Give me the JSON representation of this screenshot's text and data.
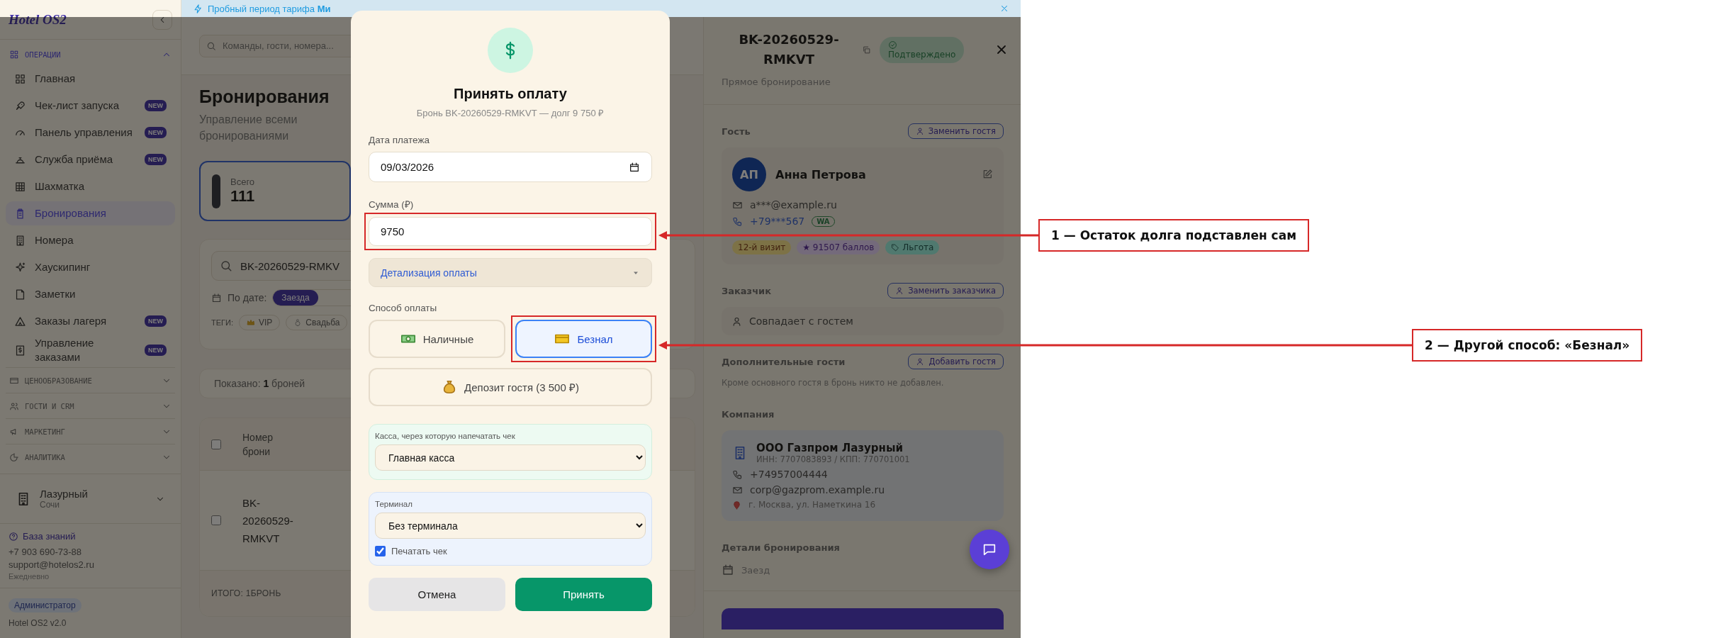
{
  "banner": {
    "text": "Пробный период тарифа **Ми**"
  },
  "sidebar": {
    "logo": "Hotel OS2",
    "sections": [
      {
        "title": "ОПЕРАЦИИ",
        "expanded": true,
        "items": [
          {
            "label": "Главная",
            "selected": false
          },
          {
            "label": "Чек-лист запуска",
            "selected": false,
            "badge": "NEW"
          },
          {
            "label": "Панель управления",
            "selected": false,
            "badge": "NEW"
          },
          {
            "label": "Служба приёма",
            "selected": false,
            "badge": "NEW"
          },
          {
            "label": "Шахматка",
            "selected": false
          },
          {
            "label": "Бронирования",
            "selected": true
          },
          {
            "label": "Номера",
            "selected": false
          },
          {
            "label": "Хаускипинг",
            "selected": false
          },
          {
            "label": "Заметки",
            "selected": false
          },
          {
            "label": "Заказы лагеря",
            "selected": false,
            "badge": "NEW"
          },
          {
            "label": "Управление заказами",
            "selected": false,
            "badge": "NEW"
          }
        ]
      },
      {
        "title": "ЦЕНООБРАЗОВАНИЕ",
        "expanded": false
      },
      {
        "title": "ГОСТИ И CRM",
        "expanded": false
      },
      {
        "title": "МАРКЕТИНГ",
        "expanded": false
      },
      {
        "title": "АНАЛИТИКА",
        "expanded": false
      }
    ],
    "property": {
      "name": "Лазурный",
      "city": "Сочи"
    },
    "help": {
      "link": "База знаний",
      "phone": "+7 903 690-73-88",
      "email": "support@hotelos2.ru",
      "hours": "Ежедневно"
    },
    "role": "Администратор",
    "version": "Hotel OS2 v2.0"
  },
  "topbar": {
    "search_placeholder": "Команды, гости, номера..."
  },
  "page": {
    "title": "Бронирования",
    "subtitle": "Управление всеми бронированиями",
    "stat": {
      "label": "Всего",
      "value": "111",
      "selected": true
    },
    "filters": {
      "search_value": "BK-20260529-RMKV",
      "date_label": "По дате:",
      "date_modes": [
        {
          "label": "Заезда",
          "selected": true
        }
      ],
      "tags_label": "ТЕГИ:",
      "tags": [
        {
          "kind": "crown",
          "label": "VIP"
        },
        {
          "kind": "ring",
          "label": "Свадьба"
        }
      ]
    },
    "summary": "Показано: **1** броней",
    "table": {
      "header_checked": false,
      "columns": [
        "Номер брони"
      ],
      "rows": [
        {
          "checked": false,
          "number": "BK-20260529-RMKVT"
        }
      ],
      "footer": "ИТОГО: 1БРОНЬ"
    }
  },
  "modal": {
    "title": "Принять оплату",
    "subtitle": "Бронь BK-20260529-RMKVT — долг 9 750 ₽",
    "date": {
      "label": "Дата платежа",
      "value": "09/03/2026"
    },
    "amount": {
      "label": "Сумма (₽)",
      "value": "9750",
      "highlighted": true
    },
    "details": {
      "label": "Детализация оплаты",
      "expanded": false
    },
    "method_label": "Способ оплаты",
    "methods": [
      {
        "kind": "cash",
        "label": "Наличные",
        "selected": false,
        "highlighted": false
      },
      {
        "kind": "card",
        "label": "Безнал",
        "selected": true,
        "highlighted": true
      },
      {
        "kind": "deposit",
        "label": "Депозит гостя (3 500 ₽)",
        "selected": false,
        "highlighted": false
      }
    ],
    "register": {
      "label": "Касса, через которую напечатать чек",
      "value": "Главная касса"
    },
    "terminal": {
      "label": "Терминал",
      "value": "Без терминала",
      "print_label": "Печатать чек",
      "print_checked": true
    },
    "buttons": [
      {
        "kind": "secondary",
        "label": "Отмена"
      },
      {
        "kind": "primary",
        "label": "Принять"
      }
    ]
  },
  "drawer": {
    "booking_id": "BK-20260529-RMKVT",
    "status": "Подтверждено",
    "source": "Прямое бронирование",
    "guest": {
      "heading": "Гость",
      "action": "Заменить гостя",
      "initials": "АП",
      "name": "Анна Петрова",
      "email": "a***@example.ru",
      "phone": "+79***567",
      "phone_badge": "WA",
      "tags": [
        {
          "kind": "visits",
          "label": "12-й визит"
        },
        {
          "kind": "points",
          "label": "★ 91507 баллов"
        },
        {
          "kind": "benefit",
          "label": "Льгота"
        }
      ]
    },
    "customer": {
      "heading": "Заказчик",
      "action": "Заменить заказчика",
      "value": "Совпадает с гостем"
    },
    "extra_guests": {
      "heading": "Дополнительные гости",
      "action": "Добавить гостя",
      "empty": "Кроме основного гостя в бронь никто не добавлен."
    },
    "company": {
      "heading": "Компания",
      "name": "ООО Газпром Лазурный",
      "ids": "ИНН: 7707083893 / КПП: 770701001",
      "phone": "+74957004444",
      "email": "corp@gazprom.example.ru",
      "address": "г. Москва, ул. Наметкина 16"
    },
    "details": {
      "heading": "Детали бронирования",
      "checkin_label": "Заезд"
    }
  },
  "annotations": [
    {
      "label": "1 — Остаток долга подставлен сам"
    },
    {
      "label": "2 — Другой способ: «Безнал»"
    }
  ]
}
